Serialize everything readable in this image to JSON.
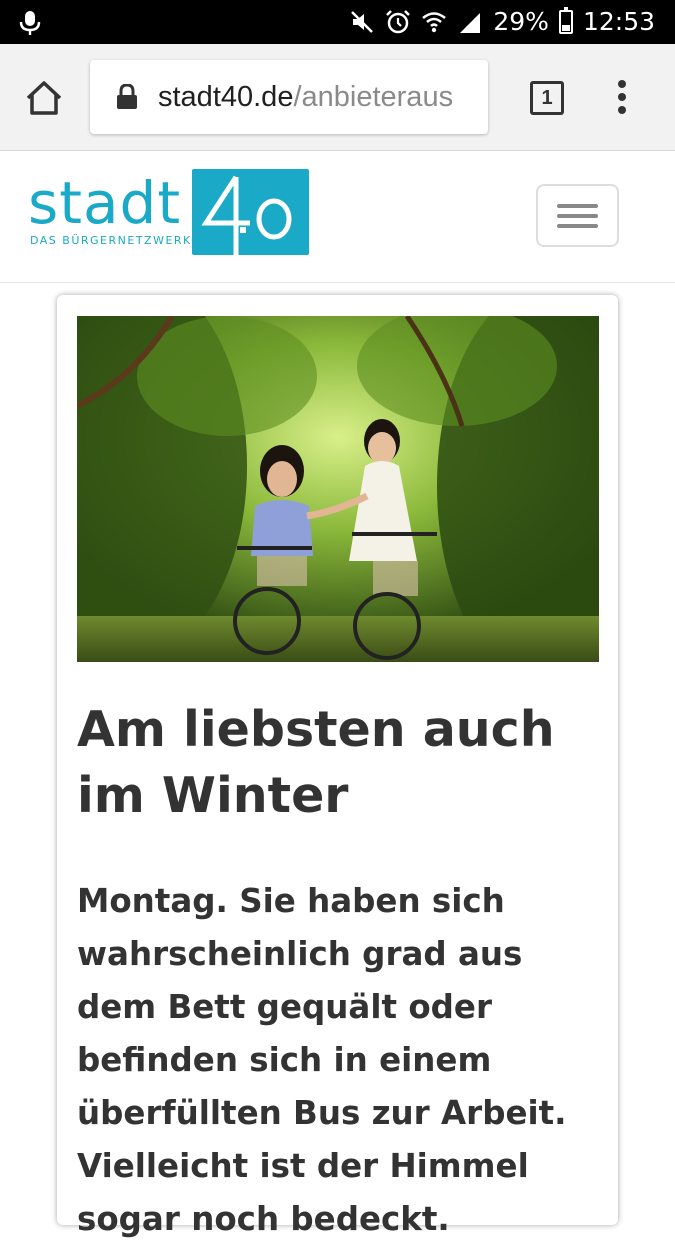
{
  "status_bar": {
    "battery": "29%",
    "time": "12:53",
    "battery_level": 0.29,
    "icons": [
      "mic-icon",
      "mute-icon",
      "alarm-icon",
      "wifi-icon",
      "signal-icon",
      "battery-icon"
    ]
  },
  "browser": {
    "url_domain": "stadt40.de",
    "url_path": "/anbieteraus",
    "tab_count": "1",
    "icons": [
      "home-icon",
      "lock-icon",
      "tabs-icon",
      "overflow-menu-icon"
    ]
  },
  "site": {
    "logo_word": "stadt",
    "logo_mark": "4.0",
    "logo_tagline": "DAS BÜRGERNETZWERK",
    "brand_color": "#1aa9c6"
  },
  "article": {
    "title": "Am liebsten auch im Winter",
    "lead": "Montag. Sie haben sich wahrscheinlich grad aus dem Bett gequält oder befinden sich in einem überfüllten Bus zur Arbeit. Vielleicht ist der Himmel sogar noch bedeckt."
  }
}
